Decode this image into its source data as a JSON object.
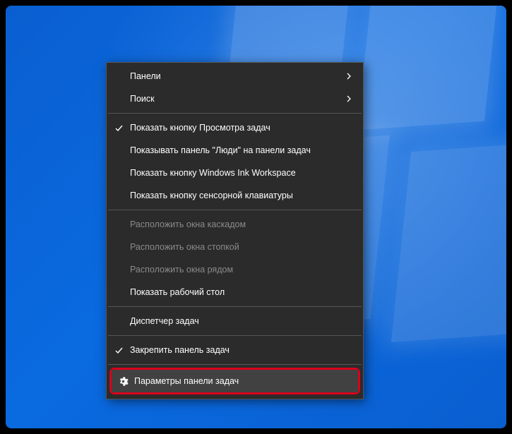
{
  "menu": {
    "items": [
      {
        "label": "Панели",
        "submenu": true
      },
      {
        "label": "Поиск",
        "submenu": true
      },
      {
        "sep": true
      },
      {
        "label": "Показать кнопку Просмотра задач",
        "checked": true
      },
      {
        "label": "Показывать панель \"Люди\" на панели задач"
      },
      {
        "label": "Показать кнопку Windows Ink Workspace"
      },
      {
        "label": "Показать кнопку сенсорной клавиатуры"
      },
      {
        "sep": true
      },
      {
        "label": "Расположить окна каскадом",
        "disabled": true
      },
      {
        "label": "Расположить окна стопкой",
        "disabled": true
      },
      {
        "label": "Расположить окна рядом",
        "disabled": true
      },
      {
        "label": "Показать рабочий стол"
      },
      {
        "sep": true
      },
      {
        "label": "Диспетчер задач"
      },
      {
        "sep": true
      },
      {
        "label": "Закрепить панель задач",
        "checked": true
      },
      {
        "sep": true
      },
      {
        "label": "Параметры панели задач",
        "icon": "gear",
        "highlighted": true
      }
    ]
  },
  "icons": {
    "check": "check-icon",
    "chev": "chevron-right-icon",
    "gear": "gear-icon"
  }
}
